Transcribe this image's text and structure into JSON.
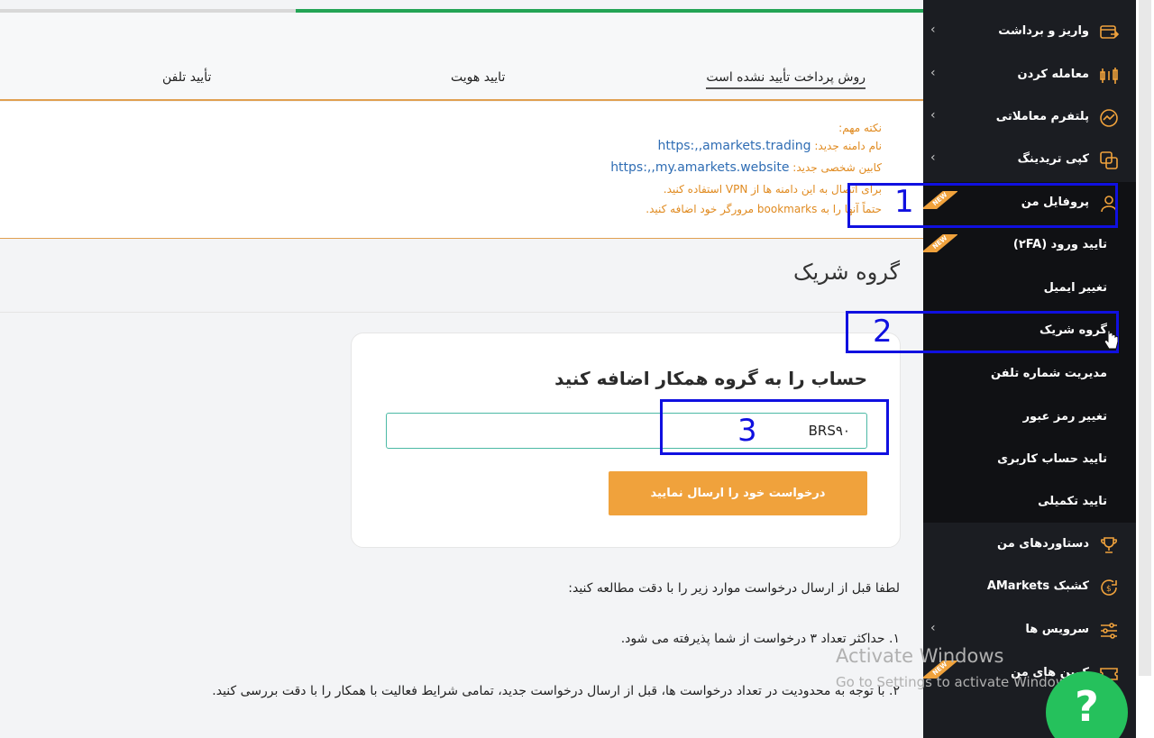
{
  "progress": {
    "value_percent": 68,
    "fill_color": "#23a455"
  },
  "tabs": {
    "payment_method": "روش پرداخت تأیید نشده است",
    "identity": "تایید هویت",
    "phone": "تأیید تلفن"
  },
  "notice": {
    "heading": "نکته مهم:",
    "domain_label": "نام دامنه جدید:",
    "domain_url": "https:,,amarkets.trading",
    "cabinet_label": "کابین شخصی جدید:",
    "cabinet_url": "https:,,my.amarkets.website",
    "vpn_text": "برای اتصال به این دامنه ها از VPN استفاده کنید.",
    "bookmark_text": "حتماً آنها را به bookmarks مرورگر خود اضافه کنید."
  },
  "section_title": "گروه شریک",
  "form": {
    "title": "حساب را به گروه همکار اضافه کنید",
    "input_value": "BRS۹۰",
    "submit_label": "درخواست خود را ارسال نمایید"
  },
  "instructions": {
    "intro": "لطفا قبل از ارسال درخواست موارد زیر را با دقت مطالعه کنید:",
    "item_1": "۱. حداکثر تعداد ۳ درخواست از شما پذیرفته می شود.",
    "item_2": "۲. با توجه به محدودیت در تعداد درخواست ها، قبل از ارسال درخواست جدید، تمامی شرایط فعالیت با همکار را با دقت بررسی کنید."
  },
  "sidebar": {
    "items": [
      {
        "label": "واریز و برداشت",
        "icon": "wallet-transfer-icon",
        "has_chevron": true
      },
      {
        "label": "معامله کردن",
        "icon": "candlestick-icon",
        "has_chevron": true
      },
      {
        "label": "پلتفرم معاملاتی",
        "icon": "platform-chart-icon",
        "has_chevron": true
      },
      {
        "label": "کپی تریدینگ",
        "icon": "copy-trading-icon",
        "has_chevron": true
      },
      {
        "label": "پروفایل من",
        "icon": "user-icon",
        "has_chevron": false,
        "badge": "NEW"
      }
    ],
    "subitems": [
      {
        "label": "تایید ورود (۲FA)",
        "badge": "NEW"
      },
      {
        "label": "تغییر ایمیل"
      },
      {
        "label": "گروه شریک"
      },
      {
        "label": "مدیریت شماره تلفن"
      },
      {
        "label": "تغییر رمز عبور"
      },
      {
        "label": "تایید حساب کاربری"
      },
      {
        "label": "تایید تکمیلی"
      }
    ],
    "bottom_items": [
      {
        "label": "دستاوردهای من",
        "icon": "trophy-icon"
      },
      {
        "label": "کشبک AMarkets",
        "icon": "cashback-icon"
      },
      {
        "label": "سرویس ها",
        "icon": "sliders-icon",
        "has_chevron": true
      },
      {
        "label": "کوپن های من",
        "icon": "coupon-icon",
        "badge": "NEW"
      }
    ],
    "accent_color": "#f0a23c"
  },
  "annotations": {
    "box_1": "1",
    "box_2": "2",
    "box_3": "3",
    "color": "#1010e0"
  },
  "watermark": {
    "line1": "Activate Windows",
    "line2": "Go to Settings to activate Windows."
  },
  "help_button": {
    "label": "?",
    "color": "#25c15c"
  }
}
